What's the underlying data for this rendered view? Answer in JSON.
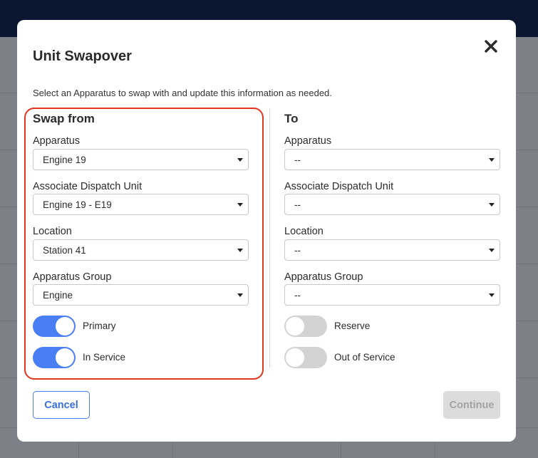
{
  "modal": {
    "title": "Unit Swapover",
    "instructions": "Select an Apparatus to swap with and update this information as needed.",
    "cancel_label": "Cancel",
    "continue_label": "Continue"
  },
  "from": {
    "heading": "Swap from",
    "apparatus_label": "Apparatus",
    "apparatus_value": "Engine 19",
    "dispatch_label": "Associate Dispatch Unit",
    "dispatch_value": "Engine 19 - E19",
    "location_label": "Location",
    "location_value": "Station 41",
    "group_label": "Apparatus Group",
    "group_value": "Engine",
    "toggle1_label": "Primary",
    "toggle1_on": true,
    "toggle2_label": "In Service",
    "toggle2_on": true
  },
  "to": {
    "heading": "To",
    "apparatus_label": "Apparatus",
    "apparatus_value": "--",
    "dispatch_label": "Associate Dispatch Unit",
    "dispatch_value": "--",
    "location_label": "Location",
    "location_value": "--",
    "group_label": "Apparatus Group",
    "group_value": "--",
    "toggle1_label": "Reserve",
    "toggle1_on": false,
    "toggle2_label": "Out of Service",
    "toggle2_on": false
  },
  "colors": {
    "accent": "#4a7ef4",
    "highlight": "#e0351f",
    "header_bg": "#0b1630"
  },
  "icons": {
    "close": "close-icon",
    "dropdown": "chevron-down-icon"
  }
}
